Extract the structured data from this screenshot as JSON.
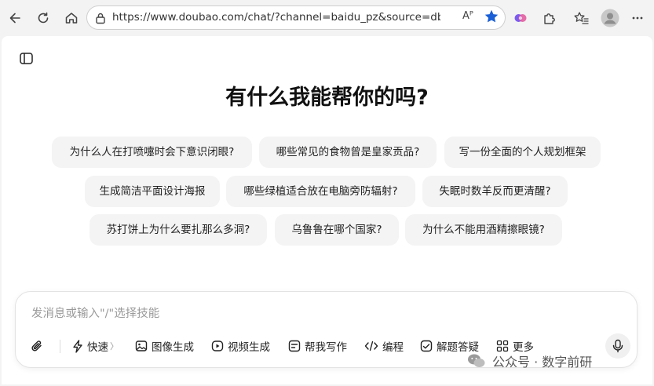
{
  "browser": {
    "url": "https://www.doubao.com/chat/?channel=baidu_pz&source=db_baid...",
    "read_aloud": "Aᴾ"
  },
  "main": {
    "heading": "有什么我能帮你的吗?",
    "suggestions": [
      "为什么人在打喷嚏时会下意识闭眼?",
      "哪些常见的食物曾是皇家贡品?",
      "写一份全面的个人规划框架",
      "生成简洁平面设计海报",
      "哪些绿植适合放在电脑旁防辐射?",
      "失眠时数羊反而更清醒?",
      "苏打饼上为什么要扎那么多洞?",
      "乌鲁鲁在哪个国家?",
      "为什么不能用酒精擦眼镜?"
    ]
  },
  "composer": {
    "placeholder": "发消息或输入\"/\"选择技能",
    "tools": {
      "quick": "快速",
      "quick_chevron": "〉",
      "image": "图像生成",
      "video": "视频生成",
      "writing": "帮我写作",
      "code": "编程",
      "solve": "解题答疑",
      "more": "更多"
    }
  },
  "watermark": "公众号 · 数字前研"
}
